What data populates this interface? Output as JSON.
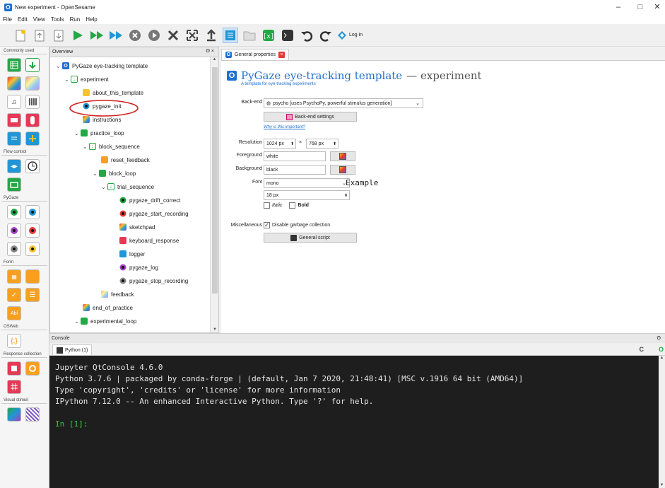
{
  "window": {
    "title": "New experiment - OpenSesame",
    "minimize": "–",
    "maximize": "□",
    "close": "✕"
  },
  "menu": [
    "File",
    "Edit",
    "View",
    "Tools",
    "Run",
    "Help"
  ],
  "toolbar": {
    "login_label": "Log in"
  },
  "left_panel": {
    "categories": [
      "Commonly used",
      "Flow control",
      "PyGaze",
      "Form",
      "OSWeb",
      "Response collection",
      "Visual stimuli"
    ],
    "abl_label": "Abl"
  },
  "overview": {
    "title": "Overview",
    "header_icons": "ʘ ×",
    "tree": [
      {
        "label": "PyGaze eye-tracking template"
      },
      {
        "label": "experiment"
      },
      {
        "label": "about_this_template"
      },
      {
        "label": "pygaze_init"
      },
      {
        "label": "instructions"
      },
      {
        "label": "practice_loop"
      },
      {
        "label": "block_sequence"
      },
      {
        "label": "reset_feedback"
      },
      {
        "label": "block_loop"
      },
      {
        "label": "trial_sequence"
      },
      {
        "label": "pygaze_drift_correct"
      },
      {
        "label": "pygaze_start_recording"
      },
      {
        "label": "sketchpad"
      },
      {
        "label": "keyboard_response"
      },
      {
        "label": "logger"
      },
      {
        "label": "pygaze_log"
      },
      {
        "label": "pygaze_stop_recording"
      },
      {
        "label": "feedback"
      },
      {
        "label": "end_of_practice"
      },
      {
        "label": "experimental_loop"
      }
    ]
  },
  "tabs": {
    "general_properties": "General properties"
  },
  "general": {
    "title": "PyGaze eye-tracking template",
    "title_suffix": "— experiment",
    "subtitle": "A template for eye-tracking experiments",
    "backend_label": "Back-end",
    "backend_value": "psycho [uses PsychoPy, powerful stimulus generation]",
    "backend_settings": "Back-end settings",
    "why_important": "Why is this important?",
    "resolution_label": "Resolution",
    "res_w": "1024 px",
    "res_x": "×",
    "res_h": "768 px",
    "foreground_label": "Foreground",
    "foreground_value": "white",
    "background_label": "Background",
    "background_value": "black",
    "font_label": "Font",
    "font_value": "mono",
    "font_example": "Example",
    "font_size": "18 px",
    "italic_label": "Italic",
    "bold_label": "Bold",
    "misc_label": "Miscellaneous",
    "gc_label": "Disable garbage collection",
    "general_script": "General script"
  },
  "console": {
    "title": "Console",
    "tab": "Python (1)",
    "lines": [
      "Jupyter QtConsole 4.6.0",
      "Python 3.7.6 | packaged by conda-forge | (default, Jan  7 2020, 21:48:41) [MSC v.1916 64 bit (AMD64)]",
      "Type 'copyright', 'credits' or 'license' for more information",
      "IPython 7.12.0 -- An enhanced Interactive Python. Type '?' for help."
    ],
    "prompt": "In [1]:"
  },
  "colors": {
    "accent": "#1f6fcf",
    "highlight_circle": "#d32020",
    "console_bg": "#1e1e1e",
    "prompt": "#39c83c"
  }
}
